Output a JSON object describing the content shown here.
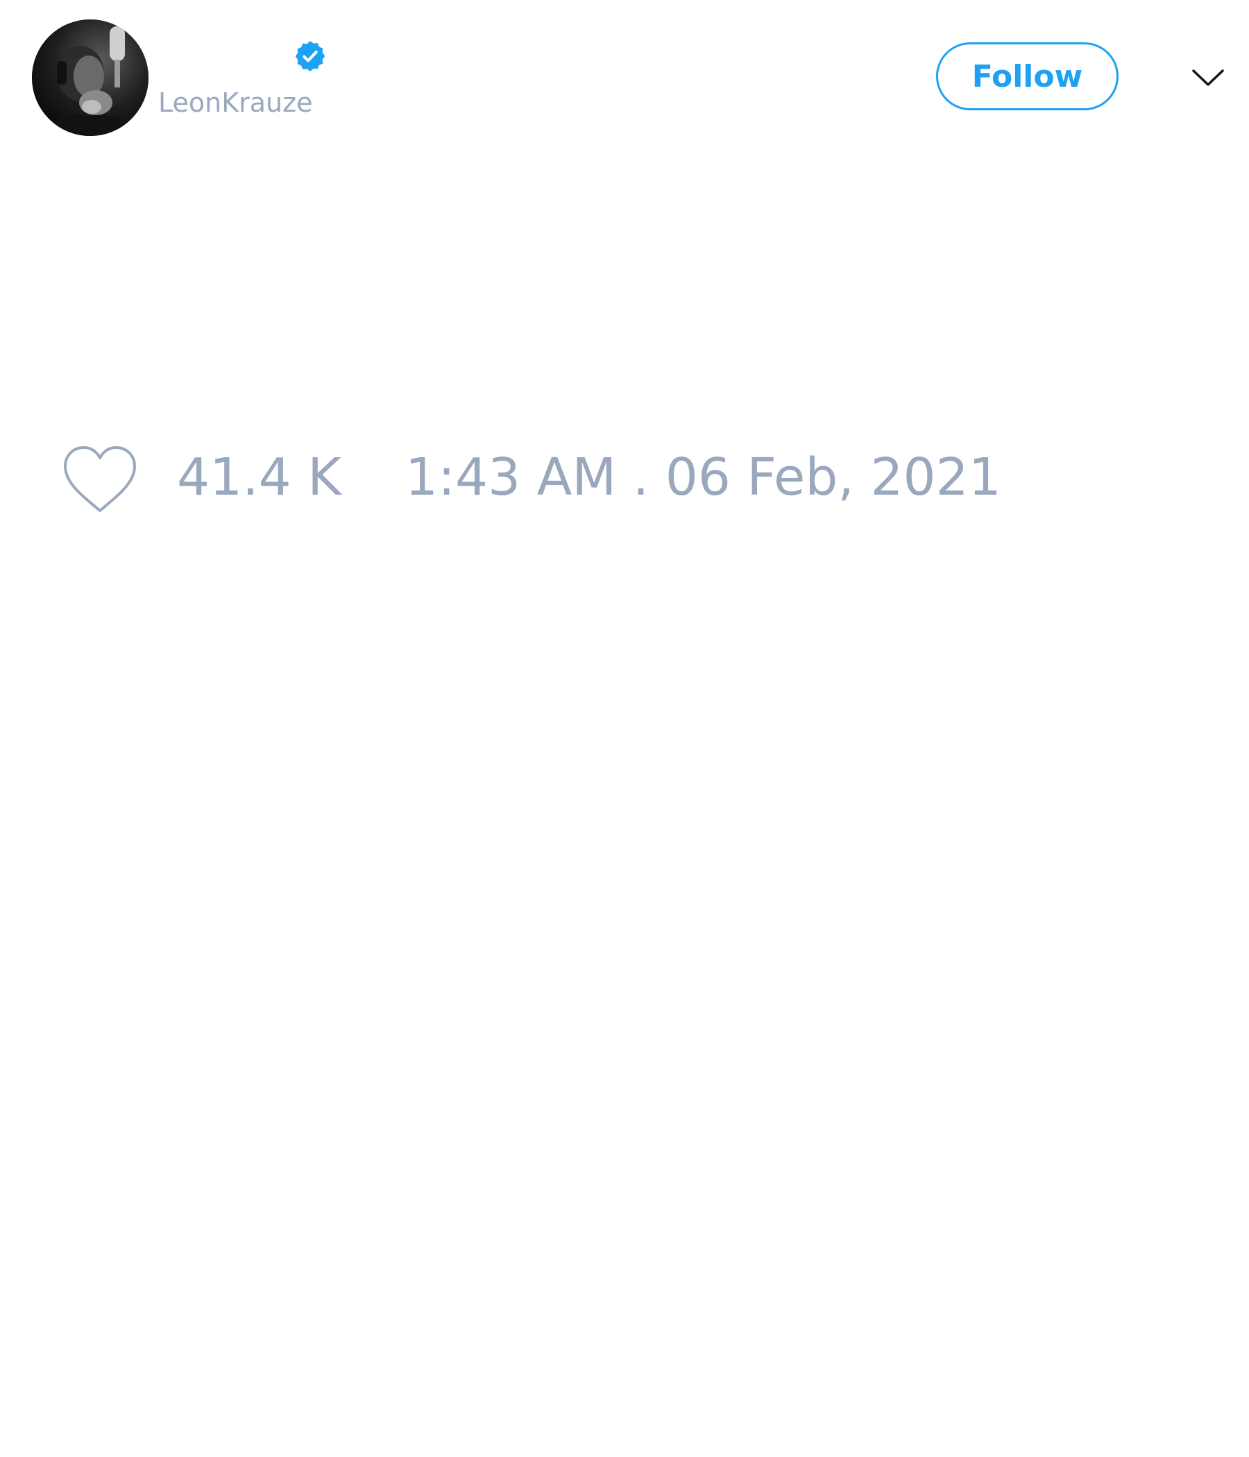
{
  "colors": {
    "accent": "#1da1f2",
    "muted_text": "#9aa8bd",
    "background": "#ffffff"
  },
  "author": {
    "display_name": "",
    "username": "LeonKrauze",
    "verified": true,
    "avatar_icon": "avatar-photo"
  },
  "header": {
    "follow_label": "Follow",
    "more_icon": "chevron-down-icon"
  },
  "tweet": {
    "like_icon": "heart-outline-icon",
    "like_count": "41.4 K",
    "timestamp": "1:43 AM . 06 Feb, 2021"
  }
}
